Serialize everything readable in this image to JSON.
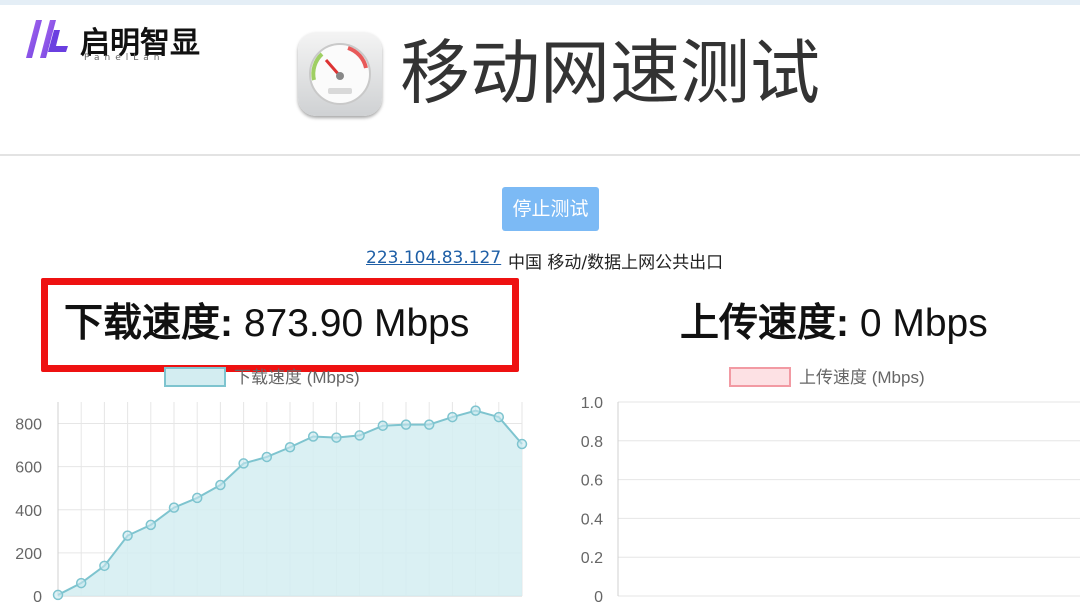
{
  "brand": {
    "name_cn": "启明智显",
    "name_en": "PanelLan"
  },
  "header": {
    "title": "移动网速测试"
  },
  "controls": {
    "stop_label": "停止测试"
  },
  "network": {
    "ip": "223.104.83.127",
    "isp": "中国 移动/数据上网公共出口"
  },
  "download": {
    "label": "下载速度:",
    "value": "873.90 Mbps"
  },
  "upload": {
    "label": "上传速度:",
    "value": "0 Mbps"
  },
  "colors": {
    "download_line": "#7ec4cf",
    "download_fill": "#d3edf1",
    "upload_line": "#f29aa3",
    "upload_fill": "#fde1e4",
    "highlight": "#ee1111",
    "button": "#7cbaf5"
  },
  "chart_data": [
    {
      "type": "area",
      "legend": "下载速度 (Mbps)",
      "x": [
        1,
        2,
        3,
        4,
        5,
        6,
        7,
        8,
        9,
        10,
        11,
        12,
        13,
        14,
        15,
        16,
        17,
        18,
        19,
        20,
        21,
        22
      ],
      "values": [
        5,
        60,
        140,
        280,
        330,
        410,
        455,
        515,
        615,
        645,
        690,
        740,
        735,
        745,
        790,
        795,
        795,
        830,
        860,
        830,
        705
      ],
      "yticks": [
        0,
        200,
        400,
        600,
        800
      ],
      "ylim": [
        0,
        900
      ],
      "grid": true,
      "legend_position": "top-center"
    },
    {
      "type": "line",
      "legend": "上传速度 (Mbps)",
      "values": [],
      "yticks": [
        "0",
        "0.2",
        "0.4",
        "0.6",
        "0.8",
        "1.0"
      ],
      "ylim": [
        0,
        1
      ],
      "grid": true,
      "legend_position": "top-center"
    }
  ]
}
